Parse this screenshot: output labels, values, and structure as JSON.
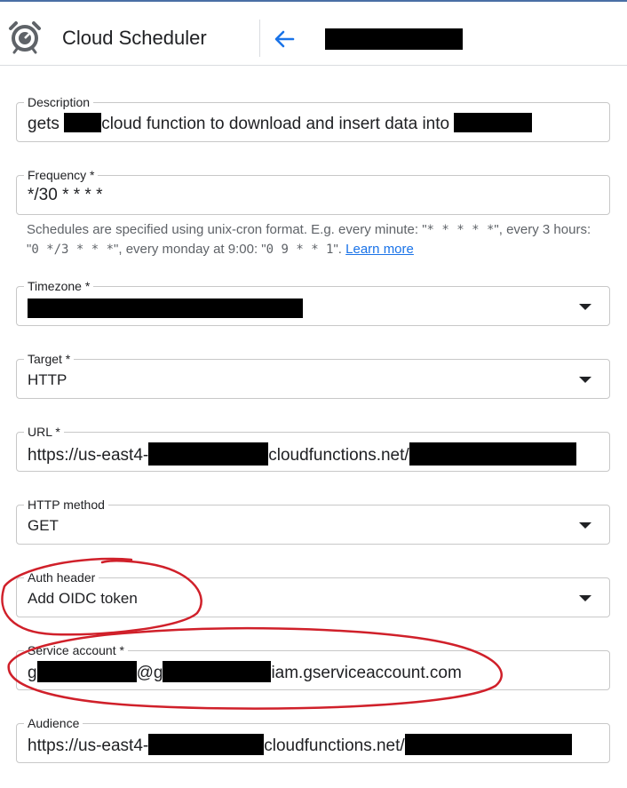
{
  "app": {
    "title": "Cloud Scheduler",
    "icon": "alarm-clock-icon"
  },
  "fields": {
    "description": {
      "label": "Description",
      "value_prefix": "gets ",
      "value_middle": "cloud function to download and insert data into "
    },
    "frequency": {
      "label": "Frequency *",
      "value": "*/30 * * * *"
    },
    "frequency_help": {
      "text1": "Schedules are specified using unix-cron format. E.g. every minute: \"",
      "code1": "* * * * *",
      "text2": "\", every 3 hours: \"",
      "code2": "0 */3 * * *",
      "text3": "\", every monday at 9:00: \"",
      "code3": "0 9 * * 1",
      "text4": "\". ",
      "link": "Learn more"
    },
    "timezone": {
      "label": "Timezone *"
    },
    "target": {
      "label": "Target *",
      "value": "HTTP"
    },
    "url": {
      "label": "URL *",
      "prefix": "https://us-east4-",
      "middle": "cloudfunctions.net/"
    },
    "http_method": {
      "label": "HTTP method",
      "value": "GET"
    },
    "auth_header": {
      "label": "Auth header",
      "value": "Add OIDC token"
    },
    "service_account": {
      "label": "Service account *",
      "prefix": "g",
      "at": "@g",
      "suffix": "iam.gserviceaccount.com"
    },
    "audience": {
      "label": "Audience",
      "prefix": "https://us-east4-",
      "middle": "cloudfunctions.net/"
    }
  },
  "colors": {
    "accent": "#1a73e8",
    "annotation": "#d0202a",
    "redaction": "#000000"
  }
}
